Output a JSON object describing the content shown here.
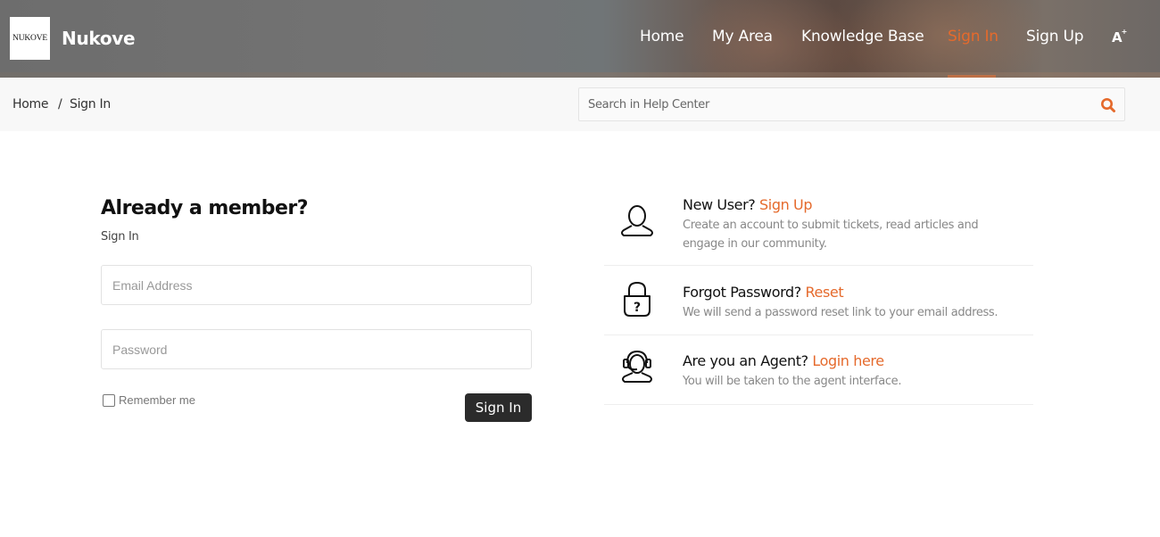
{
  "header": {
    "logo_text": "NUKOVE",
    "brand": "Nukove",
    "nav": [
      {
        "label": "Home",
        "active": false
      },
      {
        "label": "My Area",
        "active": false
      },
      {
        "label": "Knowledge Base",
        "active": false
      },
      {
        "label": "Sign In",
        "active": true
      },
      {
        "label": "Sign Up",
        "active": false
      }
    ],
    "accessibility_icon": "font-size-icon",
    "accessibility_label": "A",
    "accessibility_sup": "+"
  },
  "breadcrumb": {
    "home": "Home",
    "separator": "/",
    "current": "Sign In"
  },
  "search": {
    "placeholder": "Search in Help Center",
    "value": "",
    "icon": "search-icon"
  },
  "signin_form": {
    "title": "Already a member?",
    "subtitle": "Sign In",
    "email_placeholder": "Email Address",
    "password_placeholder": "Password",
    "remember_label": "Remember me",
    "remember_checked": false,
    "submit_label": "Sign In"
  },
  "options": [
    {
      "icon": "user-icon",
      "title": "New User?",
      "link": "Sign Up",
      "description": "Create an account to submit tickets, read articles and engage in our community."
    },
    {
      "icon": "lock-question-icon",
      "title": "Forgot Password?",
      "link": "Reset",
      "description": "We will send a password reset link to your email address."
    },
    {
      "icon": "agent-headset-icon",
      "title": "Are you an Agent?",
      "link": "Login here",
      "description": "You will be taken to the agent interface."
    }
  ],
  "colors": {
    "accent": "#e56a2c",
    "button_dark": "#2b2b2b",
    "subbar_bg": "#f8f8f8"
  }
}
